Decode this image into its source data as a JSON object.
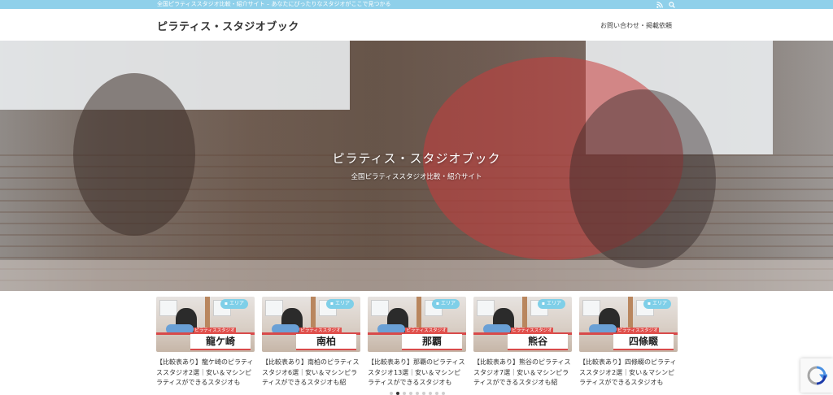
{
  "topbar": {
    "tagline": "全国ピラティススタジオ比較・紹介サイト – あなたにぴったりなスタジオがここで見つかる",
    "icons": [
      "rss-icon",
      "search-icon"
    ]
  },
  "header": {
    "site_title": "ピラティス・スタジオブック",
    "nav_contact": "お問い合わせ・掲載依頼"
  },
  "hero": {
    "title": "ピラティス・スタジオブック",
    "subtitle": "全国ピラティススタジオ比較・紹介サイト"
  },
  "cards": [
    {
      "badge": "エリア",
      "thumb_label": "ピラティススタジオ",
      "place": "龍ケ崎",
      "title": "【比較表あり】龍ケ崎のピラティススタジオ2選｜安い＆マシンピラティスができるスタジオも"
    },
    {
      "badge": "エリア",
      "thumb_label": "ピラティススタジオ",
      "place": "南柏",
      "title": "【比較表あり】南柏のピラティススタジオ6選｜安い＆マシンピラティスができるスタジオも紹"
    },
    {
      "badge": "エリア",
      "thumb_label": "ピラティススタジオ",
      "place": "那覇",
      "title": "【比較表あり】那覇のピラティススタジオ13選｜安い＆マシンピラティスができるスタジオも"
    },
    {
      "badge": "エリア",
      "thumb_label": "ピラティススタジオ",
      "place": "熊谷",
      "title": "【比較表あり】熊谷のピラティススタジオ7選｜安い＆マシンピラティスができるスタジオも紹"
    },
    {
      "badge": "エリア",
      "thumb_label": "ピラティススタジオ",
      "place": "四條畷",
      "title": "【比較表あり】四條畷のピラティススタジオ2選｜安い＆マシンピラティスができるスタジオも"
    }
  ],
  "pager": {
    "count": 9,
    "active_index": 1
  },
  "recaptcha": {
    "icon": "recaptcha-icon"
  },
  "colors": {
    "topbar": "#8fd0ea",
    "badge": "#7fcfe8",
    "accent_red": "#d84a4a"
  }
}
